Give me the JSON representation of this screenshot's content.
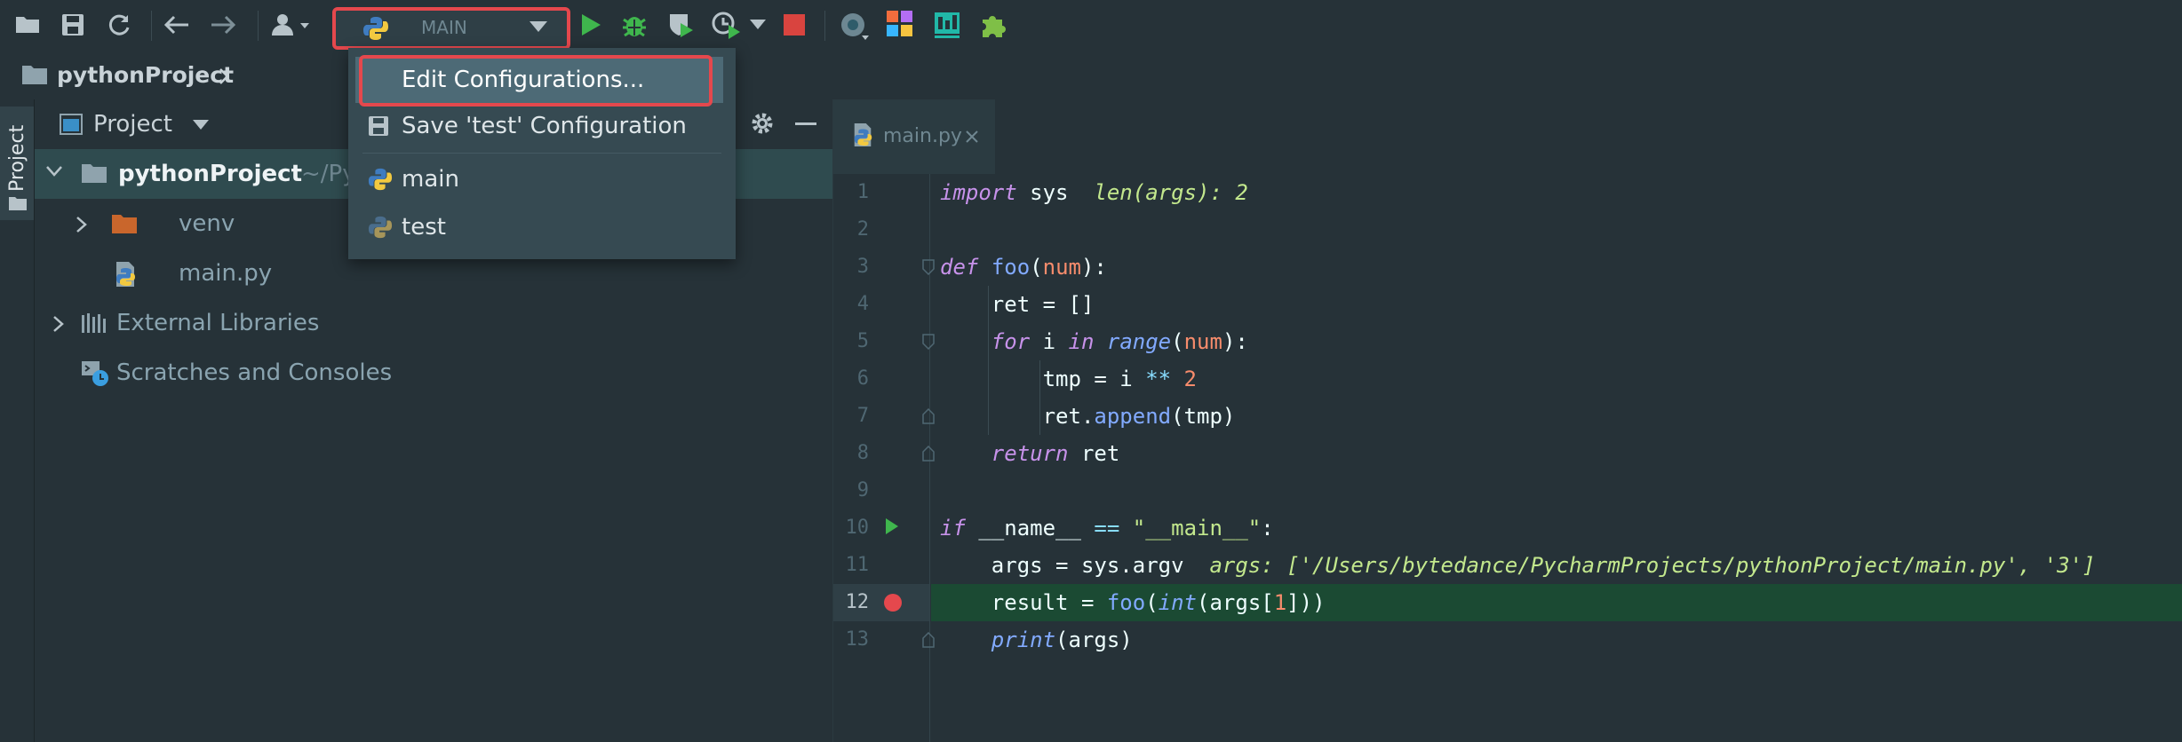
{
  "toolbar": {
    "run_config": "MAIN"
  },
  "breadcrumb": {
    "project": "pythonProject"
  },
  "sidestrip": {
    "label": "Project"
  },
  "project_panel": {
    "view_selector": "Project",
    "tree": {
      "root_name": "pythonProject",
      "root_path": "~/Pyc",
      "items": [
        "venv",
        "main.py",
        "External Libraries",
        "Scratches and Consoles"
      ]
    }
  },
  "dropdown": {
    "items": [
      "Edit Configurations...",
      "Save 'test' Configuration",
      "main",
      "test"
    ]
  },
  "editor": {
    "tab": "main.py",
    "line_numbers": [
      "1",
      "2",
      "3",
      "4",
      "5",
      "6",
      "7",
      "8",
      "9",
      "10",
      "11",
      "12",
      "13"
    ],
    "code": {
      "l1_import": "import",
      "l1_module": " sys",
      "l1_hint": "len(args): 2",
      "l3_def": "def",
      "l3_name": "foo",
      "l3_param": "num",
      "l4": "ret = []",
      "l5_for": "for",
      "l5_i": " i ",
      "l5_in": "in",
      "l5_range": "range",
      "l5_param": "num",
      "l6_a": "tmp = i ",
      "l6_op": "**",
      "l6_num": "2",
      "l7_a": "ret.",
      "l7_fn": "append",
      "l7_b": "(tmp)",
      "l8_return": "return",
      "l8_b": " ret",
      "l10_if": "if",
      "l10_a": " __name__ ",
      "l10_op": "==",
      "l10_str": "\"__main__\"",
      "l11_a": "args = sys.argv",
      "l11_hint": "args: ['/Users/bytedance/PycharmProjects/pythonProject/main.py', '3']",
      "l12_a": "result = ",
      "l12_fn": "foo",
      "l12_int": "int",
      "l12_b": "(args[",
      "l12_num": "1",
      "l12_c": "]))",
      "l13_print": "print",
      "l13_b": "(args)"
    }
  },
  "colors": {
    "background": "#263238",
    "menu_highlight": "#4d6a76",
    "current_line": "#1b4a33",
    "annotation_red": "#e5484d",
    "run_green": "#3fb64d"
  }
}
